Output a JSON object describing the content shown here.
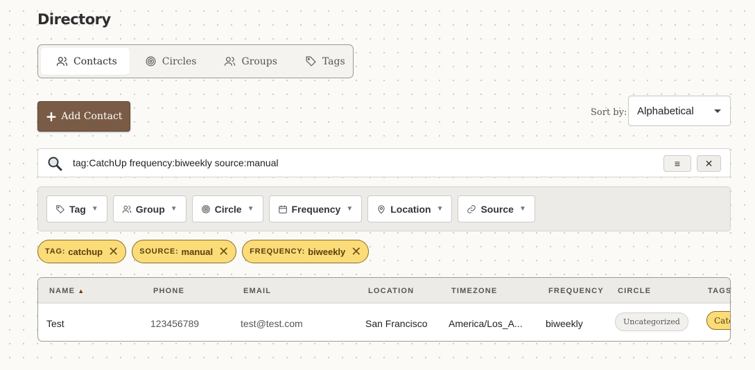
{
  "page": {
    "title": "Directory"
  },
  "tabs": [
    {
      "label": "Contacts",
      "icon": "users-icon",
      "active": true
    },
    {
      "label": "Circles",
      "icon": "target-icon",
      "active": false
    },
    {
      "label": "Groups",
      "icon": "users-icon",
      "active": false
    },
    {
      "label": "Tags",
      "icon": "tag-icon",
      "active": false
    }
  ],
  "toolbar": {
    "add_label": "Add Contact",
    "sort_label": "Sort by:",
    "sort_value": "Alphabetical"
  },
  "search": {
    "value": "tag:CatchUp frequency:biweekly source:manual"
  },
  "filters": [
    {
      "label": "Tag",
      "icon": "tag-icon"
    },
    {
      "label": "Group",
      "icon": "users-icon"
    },
    {
      "label": "Circle",
      "icon": "target-icon"
    },
    {
      "label": "Frequency",
      "icon": "calendar-icon"
    },
    {
      "label": "Location",
      "icon": "map-pin-icon"
    },
    {
      "label": "Source",
      "icon": "link-icon"
    }
  ],
  "active_filters": [
    {
      "key": "TAG:",
      "value": "catchup"
    },
    {
      "key": "SOURCE:",
      "value": "manual"
    },
    {
      "key": "FREQUENCY:",
      "value": "biweekly"
    }
  ],
  "table": {
    "columns": [
      "NAME",
      "PHONE",
      "EMAIL",
      "LOCATION",
      "TIMEZONE",
      "FREQUENCY",
      "CIRCLE",
      "TAGS"
    ],
    "sort_indicator": "▲",
    "rows": [
      {
        "name": "Test",
        "phone": "123456789",
        "email": "test@test.com",
        "location": "San Francisco",
        "timezone": "America/Los_A...",
        "frequency": "biweekly",
        "circle": "Uncategorized",
        "tag": "CatchUp"
      }
    ]
  },
  "colors": {
    "accent_brown": "#7a5c46",
    "chip_yellow": "#fbdc79",
    "background": "#fbfaf7"
  }
}
